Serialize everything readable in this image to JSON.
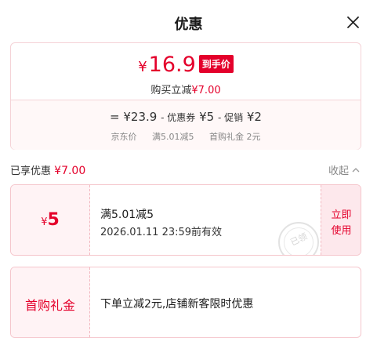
{
  "header": {
    "title": "优惠",
    "close_icon": "close-icon"
  },
  "summary": {
    "currency": "¥",
    "final_price": "16.9",
    "tag": "到手价",
    "save_label": "购买立减",
    "save_amount": "¥7.00",
    "calc": {
      "eq": "=",
      "base": "¥23.9",
      "coupon_label": "- 优惠券",
      "coupon_value": "¥5",
      "promo_label": "- 促销",
      "promo_value": "¥2"
    },
    "labels": {
      "base": "京东价",
      "coupon": "满5.01减5",
      "promo": "首购礼金 2元"
    }
  },
  "enjoyed": {
    "label": "已享优惠",
    "amount": "¥7.00",
    "collapse": "收起",
    "collapse_icon": "chevron-up-icon"
  },
  "coupon": {
    "currency": "¥",
    "value": "5",
    "title": "满5.01减5",
    "expire": "2026.01.11 23:59前有效",
    "stamp": "已领",
    "action_line1": "立即",
    "action_line2": "使用"
  },
  "gift": {
    "name": "首购礼金",
    "desc": "下单立减2元,店铺新客限时优惠"
  },
  "colors": {
    "accent": "#e4002b",
    "border": "#f5c6cc",
    "tint": "#fff3f5"
  }
}
